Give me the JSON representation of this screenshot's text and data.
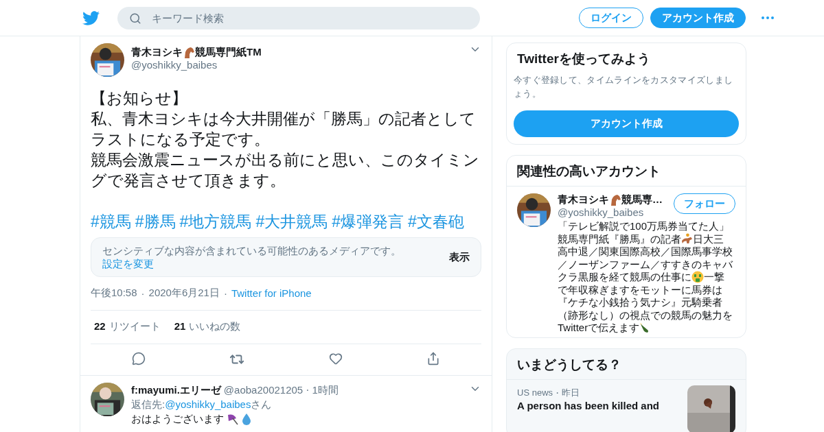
{
  "header": {
    "search": {
      "placeholder": "キーワード検索"
    },
    "login": "ログイン",
    "signup": "アカウント作成"
  },
  "tweet": {
    "author": {
      "name_parts": [
        "青木ヨシキ",
        "競馬専門紙TM"
      ],
      "handle": "@yoshikky_baibes"
    },
    "lines": [
      "【お知らせ】",
      "私、青木ヨシキは今大井開催が「勝馬」の記者として",
      "ラストになる予定です。",
      "競馬会激震ニュースが出る前にと思い、このタイミン",
      "グで発言させて頂きます。"
    ],
    "hashtags": [
      "#競馬",
      "#勝馬",
      "#地方競馬",
      "#大井競馬",
      "#爆弾発言",
      "#文春砲"
    ],
    "sensitive": {
      "text": "センシティブな内容が含まれている可能性のあるメディアです。",
      "link": "設定を変更",
      "button": "表示"
    },
    "time": "午後10:58",
    "separator": "·",
    "date": "2020年6月21日",
    "source": "Twitter for iPhone",
    "stats": [
      {
        "count": "22",
        "label": "リツイート"
      },
      {
        "count": "21",
        "label": "いいねの数"
      }
    ]
  },
  "reply": {
    "name": "f:mayumi.エリーゼ",
    "handle": "@aoba20021205",
    "separator": "·",
    "time": "1時間",
    "reply_prefix": "返信先: ",
    "reply_to": "@yoshikky_baibes",
    "reply_suffix": "さん",
    "text": "おはようございます"
  },
  "signup_card": {
    "title": "Twitterを使ってみよう",
    "text": "今すぐ登録して、タイムラインをカスタマイズしましょう。",
    "button": "アカウント作成"
  },
  "related": {
    "title": "関連性の高いアカウント",
    "accounts": [
      {
        "name_parts": [
          "青木ヨシキ",
          "競馬専…"
        ],
        "handle": "@yoshikky_baibes",
        "follow": "フォロー",
        "bio": [
          [
            {
              "kind": "text",
              "text": "「テレビ解説で100万馬券当てた人」"
            }
          ],
          [
            {
              "kind": "text",
              "text": "競馬専門紙『勝馬』の記者"
            },
            {
              "kind": "icon"
            },
            {
              "kind": "text",
              "text": "日大三"
            }
          ],
          [
            {
              "kind": "text",
              "text": "高中退／関東国際高校／国際馬事学校"
            }
          ],
          [
            {
              "kind": "text",
              "text": "／ノーザンファーム／すすきのキャバ"
            }
          ],
          [
            {
              "kind": "text",
              "text": "クラ黒服を経て競馬の仕事に"
            },
            {
              "kind": "icon"
            },
            {
              "kind": "text",
              "text": "一撃"
            }
          ],
          [
            {
              "kind": "text",
              "text": "で年収稼ぎますをモットーに馬券は"
            }
          ],
          [
            {
              "kind": "text",
              "text": "『ケチな小銭拾う気ナシ』元騎乗者"
            }
          ],
          [
            {
              "kind": "text",
              "text": "（跡形なし）の視点での競馬の魅力を"
            }
          ],
          [
            {
              "kind": "text",
              "text": "Twitterで伝えます"
            },
            {
              "kind": "icon"
            }
          ]
        ]
      }
    ]
  },
  "trends": {
    "title": "いまどうしてる？",
    "items": [
      {
        "category": "US news",
        "separator": "·",
        "time": "昨日",
        "headline": "A person has been killed and"
      }
    ]
  }
}
